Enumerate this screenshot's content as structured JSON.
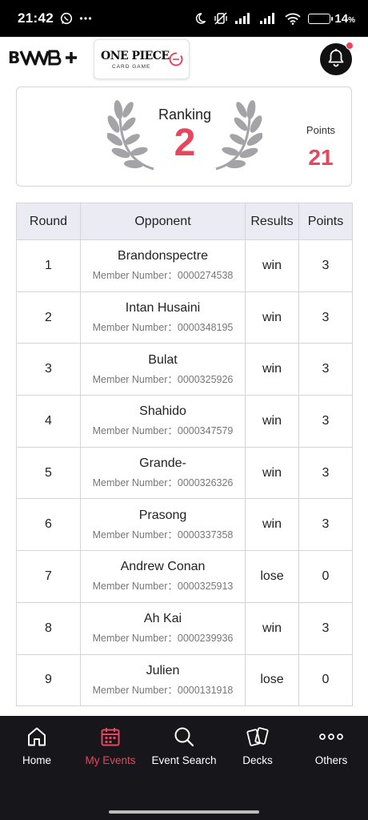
{
  "status_bar": {
    "time": "21:42",
    "battery_percent": "14",
    "battery_unit": "%"
  },
  "header": {
    "brand": "B···+",
    "game_title": "ONE PIECE",
    "game_subtitle": "CARD GAME"
  },
  "ranking": {
    "label": "Ranking",
    "value": "2",
    "points_label": "Points",
    "points_value": "21"
  },
  "table": {
    "headers": {
      "round": "Round",
      "opponent": "Opponent",
      "results": "Results",
      "points": "Points"
    },
    "member_prefix": "Member Number：",
    "rows": [
      {
        "round": "1",
        "name": "Brandonspectre",
        "member": "Member Number：0000274538",
        "result": "win",
        "points": "3"
      },
      {
        "round": "2",
        "name": "Intan Husaini",
        "member": "Member Number：0000348195",
        "result": "win",
        "points": "3"
      },
      {
        "round": "3",
        "name": "Bulat",
        "member": "Member Number：0000325926",
        "result": "win",
        "points": "3"
      },
      {
        "round": "4",
        "name": "Shahido",
        "member": "Member Number：0000347579",
        "result": "win",
        "points": "3"
      },
      {
        "round": "5",
        "name": "Grande-",
        "member": "Member Number：0000326326",
        "result": "win",
        "points": "3"
      },
      {
        "round": "6",
        "name": "Prasong",
        "member": "Member Number：0000337358",
        "result": "win",
        "points": "3"
      },
      {
        "round": "7",
        "name": "Andrew Conan",
        "member": "Member Number：0000325913",
        "result": "lose",
        "points": "0"
      },
      {
        "round": "8",
        "name": "Ah Kai",
        "member": "Member Number：0000239936",
        "result": "win",
        "points": "3"
      },
      {
        "round": "9",
        "name": "Julien",
        "member": "Member Number：0000131918",
        "result": "lose",
        "points": "0"
      }
    ]
  },
  "nav": {
    "items": [
      {
        "label": "Home",
        "icon": "home-icon",
        "active": false
      },
      {
        "label": "My Events",
        "icon": "calendar-icon",
        "active": true
      },
      {
        "label": "Event Search",
        "icon": "search-icon",
        "active": false
      },
      {
        "label": "Decks",
        "icon": "cards-icon",
        "active": false
      },
      {
        "label": "Others",
        "icon": "more-icon",
        "active": false
      }
    ]
  },
  "colors": {
    "accent": "#e8455f",
    "nav_bg": "#17171b",
    "header_cell_bg": "#ebebf3",
    "battery": "#f5b400"
  }
}
